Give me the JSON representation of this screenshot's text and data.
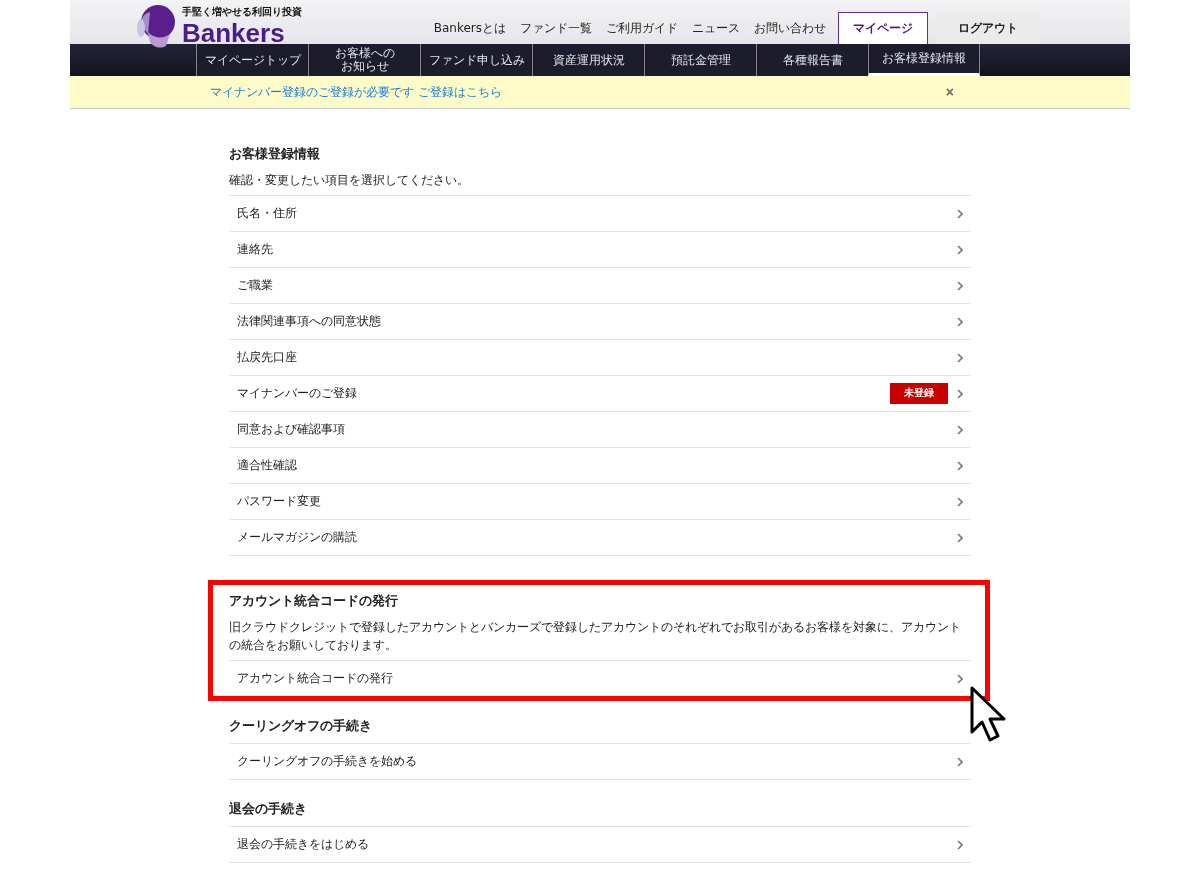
{
  "header": {
    "tagline": "手堅く増やせる利回り投資",
    "logo": "Bankers",
    "nav": [
      {
        "label": "Bankersとは",
        "kind": "link"
      },
      {
        "label": "ファンド一覧",
        "kind": "link"
      },
      {
        "label": "ご利用ガイド",
        "kind": "link"
      },
      {
        "label": "ニュース",
        "kind": "link"
      },
      {
        "label": "お問い合わせ",
        "kind": "link"
      },
      {
        "label": "マイページ",
        "kind": "primary"
      },
      {
        "label": "ログアウト",
        "kind": "secondary"
      }
    ],
    "subnav": [
      {
        "label": "マイページトップ",
        "selected": false
      },
      {
        "lines": [
          "お客様への",
          "お知らせ"
        ],
        "selected": false
      },
      {
        "label": "ファンド申し込み",
        "selected": false
      },
      {
        "label": "資産運用状況",
        "selected": false
      },
      {
        "label": "預託金管理",
        "selected": false
      },
      {
        "label": "各種報告書",
        "selected": false
      },
      {
        "label": "お客様登録情報",
        "selected": true
      }
    ]
  },
  "notice": {
    "text": "マイナンバー登録のご登録が必要です ご登録はこちら",
    "close": "×"
  },
  "sections": [
    {
      "title": "お客様登録情報",
      "description": "確認・変更したい項目を選択してください。",
      "highlighted": false,
      "items": [
        {
          "label": "氏名・住所"
        },
        {
          "label": "連絡先"
        },
        {
          "label": "ご職業"
        },
        {
          "label": "法律関連事項への同意状態"
        },
        {
          "label": "払戻先口座"
        },
        {
          "label": "マイナンバーのご登録",
          "badge": "未登録"
        },
        {
          "label": "同意および確認事項"
        },
        {
          "label": "適合性確認"
        },
        {
          "label": "パスワード変更"
        },
        {
          "label": "メールマガジンの購読"
        }
      ]
    },
    {
      "title": "アカウント統合コードの発行",
      "description": "旧クラウドクレジットで登録したアカウントとバンカーズで登録したアカウントのそれぞれでお取引があるお客様を対象に、アカウントの統合をお願いしております。",
      "highlighted": true,
      "items": [
        {
          "label": "アカウント統合コードの発行"
        }
      ]
    },
    {
      "title": "クーリングオフの手続き",
      "highlighted": false,
      "items": [
        {
          "label": "クーリングオフの手続きを始める"
        }
      ]
    },
    {
      "title": "退会の手続き",
      "highlighted": false,
      "items": [
        {
          "label": "退会の手続きをはじめる"
        }
      ]
    }
  ]
}
